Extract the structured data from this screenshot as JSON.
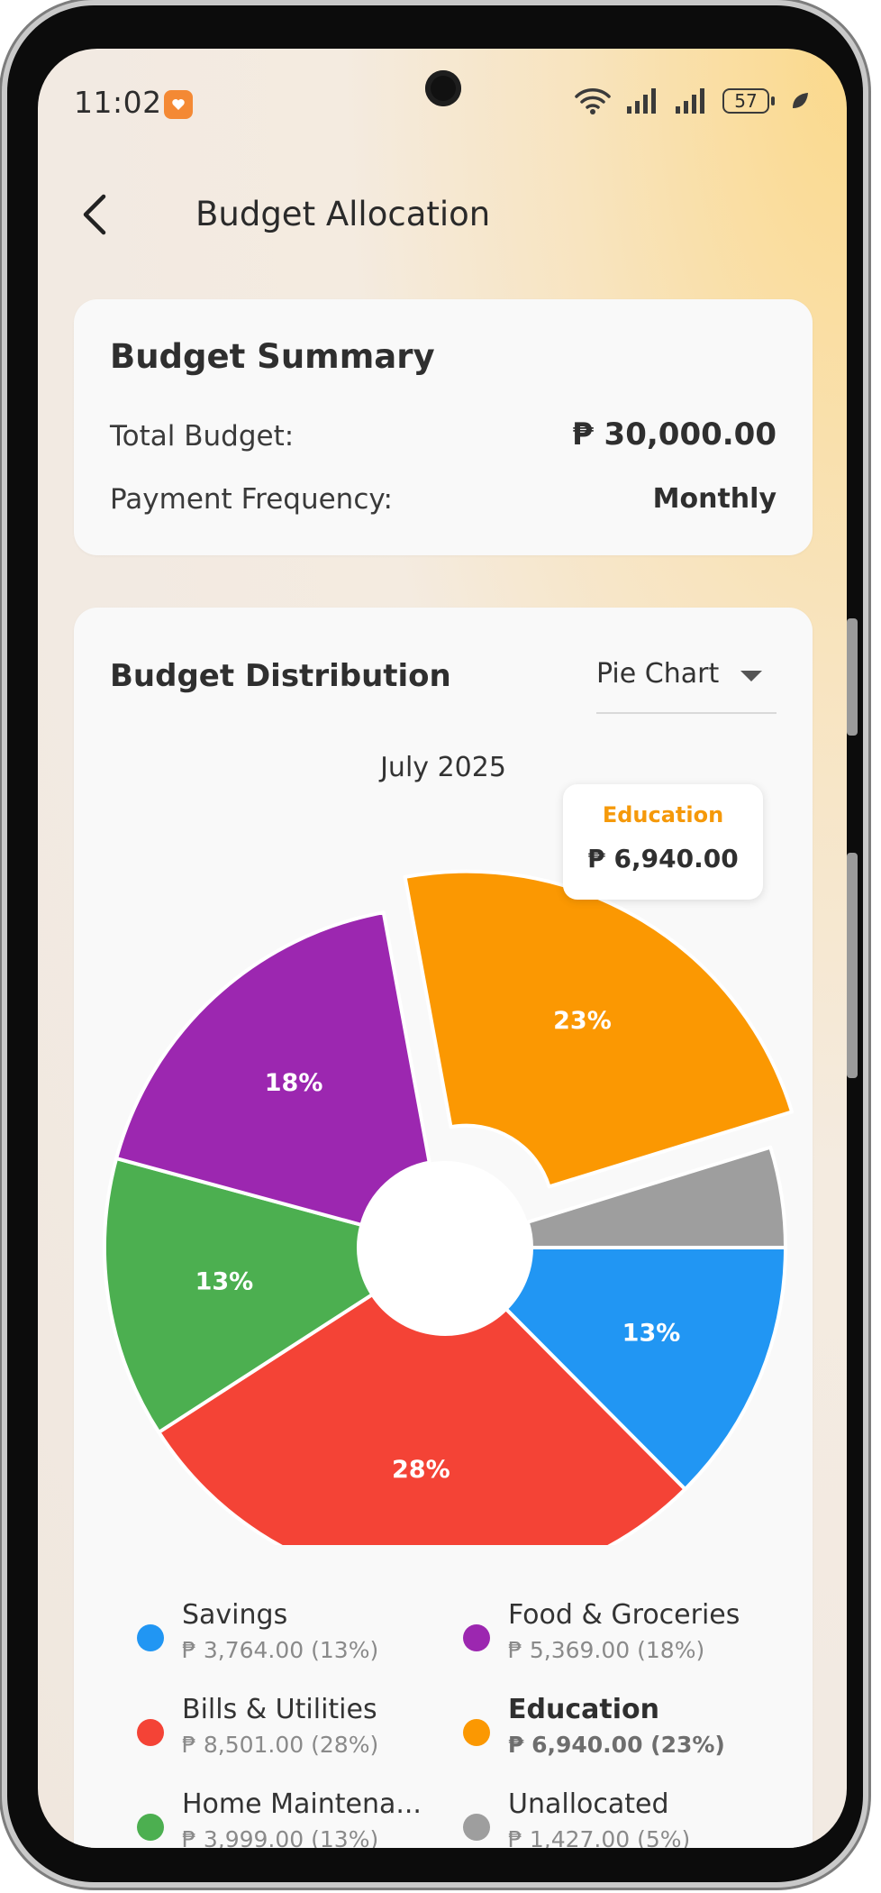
{
  "status_bar": {
    "time": "11:02",
    "battery": "57"
  },
  "app_bar": {
    "title": "Budget Allocation"
  },
  "summary": {
    "title": "Budget Summary",
    "total_label": "Total Budget:",
    "total_value": "₱ 30,000.00",
    "frequency_label": "Payment Frequency:",
    "frequency_value": "Monthly"
  },
  "distribution": {
    "title": "Budget Distribution",
    "chart_type_selected": "Pie Chart",
    "period": "July 2025",
    "tooltip": {
      "category": "Education",
      "amount": "₱ 6,940.00"
    },
    "selected_category": "Education"
  },
  "legend": [
    {
      "name": "Savings",
      "amount": "₱ 3,764.00 (13%)",
      "color": "#2196F3"
    },
    {
      "name": "Food & Groceries",
      "amount": "₱ 5,369.00 (18%)",
      "color": "#9C27B0"
    },
    {
      "name": "Bills & Utilities",
      "amount": "₱ 8,501.00 (28%)",
      "color": "#F44336"
    },
    {
      "name": "Education",
      "amount": "₱ 6,940.00 (23%)",
      "color": "#FB9802"
    },
    {
      "name": "Home Maintena...",
      "amount": "₱ 3,999.00 (13%)",
      "color": "#4CAF50"
    },
    {
      "name": "Unallocated",
      "amount": "₱ 1,427.00 (5%)",
      "color": "#9E9E9E"
    }
  ],
  "chart_data": {
    "type": "pie",
    "title": "July 2025",
    "categories": [
      "Savings",
      "Bills & Utilities",
      "Home Maintena...",
      "Food & Groceries",
      "Education",
      "Unallocated"
    ],
    "values": [
      3764,
      8501,
      3999,
      5369,
      6940,
      1427
    ],
    "percent_labels": [
      "13%",
      "28%",
      "13%",
      "18%",
      "23%",
      ""
    ],
    "colors": [
      "#2196F3",
      "#F44336",
      "#4CAF50",
      "#9C27B0",
      "#FB9802",
      "#9E9E9E"
    ],
    "highlighted": "Education",
    "donut_hole": true
  }
}
